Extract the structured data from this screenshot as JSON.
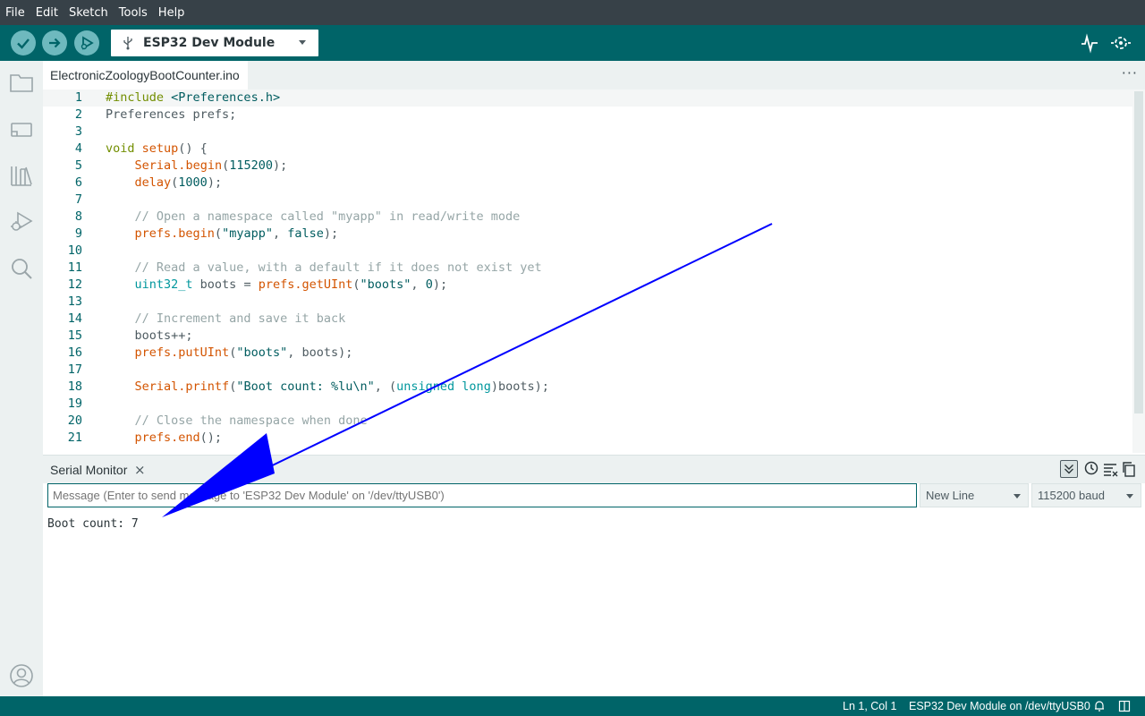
{
  "menu": [
    "File",
    "Edit",
    "Sketch",
    "Tools",
    "Help"
  ],
  "toolbar": {
    "board": "ESP32 Dev Module",
    "icons": [
      "verify-icon",
      "upload-icon",
      "debug-icon",
      "usb-icon",
      "serial-plotter-icon",
      "serial-monitor-icon"
    ]
  },
  "sidebar_icons": [
    "folder-icon",
    "board-manager-icon",
    "library-icon",
    "debug-icon",
    "search-icon",
    "account-icon"
  ],
  "tab": {
    "filename": "ElectronicZoologyBootCounter.ino",
    "more": "···"
  },
  "editor": {
    "lines": [
      {
        "n": "1"
      },
      {
        "n": "2"
      },
      {
        "n": "3"
      },
      {
        "n": "4"
      },
      {
        "n": "5"
      },
      {
        "n": "6"
      },
      {
        "n": "7"
      },
      {
        "n": "8"
      },
      {
        "n": "9"
      },
      {
        "n": "10"
      },
      {
        "n": "11"
      },
      {
        "n": "12"
      },
      {
        "n": "13"
      },
      {
        "n": "14"
      },
      {
        "n": "15"
      },
      {
        "n": "16"
      },
      {
        "n": "17"
      },
      {
        "n": "18"
      },
      {
        "n": "19"
      },
      {
        "n": "20"
      },
      {
        "n": "21"
      }
    ],
    "code": {
      "l1a": "#include",
      "l1b": " <Preferences.h>",
      "l2": "Preferences prefs;",
      "l4a": "void",
      "l4b": " ",
      "l4c": "setup",
      "l4d": "() {",
      "l5a": "    ",
      "l5b": "Serial",
      "l5c": ".",
      "l5d": "begin",
      "l5e": "(",
      "l5f": "115200",
      "l5g": ");",
      "l6a": "    ",
      "l6b": "delay",
      "l6c": "(",
      "l6d": "1000",
      "l6e": ");",
      "l8": "    // Open a namespace called \"myapp\" in read/write mode",
      "l9a": "    ",
      "l9b": "prefs.begin",
      "l9c": "(",
      "l9d": "\"myapp\"",
      "l9e": ", ",
      "l9f": "false",
      "l9g": ");",
      "l11": "    // Read a value, with a default if it does not exist yet",
      "l12a": "    ",
      "l12b": "uint32_t",
      "l12c": " boots = ",
      "l12d": "prefs.getUInt",
      "l12e": "(",
      "l12f": "\"boots\"",
      "l12g": ", ",
      "l12h": "0",
      "l12i": ");",
      "l14": "    // Increment and save it back",
      "l15": "    boots++;",
      "l16a": "    ",
      "l16b": "prefs.putUInt",
      "l16c": "(",
      "l16d": "\"boots\"",
      "l16e": ", boots);",
      "l18a": "    ",
      "l18b": "Serial.printf",
      "l18c": "(",
      "l18d": "\"Boot count: %lu\\n\"",
      "l18e": ", (",
      "l18f": "unsigned long",
      "l18g": ")boots);",
      "l20": "    // Close the namespace when done",
      "l21a": "    ",
      "l21b": "prefs.end",
      "l21c": "();"
    }
  },
  "serial_monitor": {
    "title": "Serial Monitor",
    "close": "×",
    "input_placeholder": "Message (Enter to send message to 'ESP32 Dev Module' on '/dev/ttyUSB0')",
    "line_ending": "New Line",
    "baud": "115200 baud",
    "output": "Boot count: 7"
  },
  "status": {
    "position": "Ln 1, Col 1",
    "board": "ESP32 Dev Module on /dev/ttyUSB0"
  },
  "colors": {
    "toolbar": "#006468",
    "menubar": "#374148",
    "annotation_arrow": "#0000ff"
  }
}
